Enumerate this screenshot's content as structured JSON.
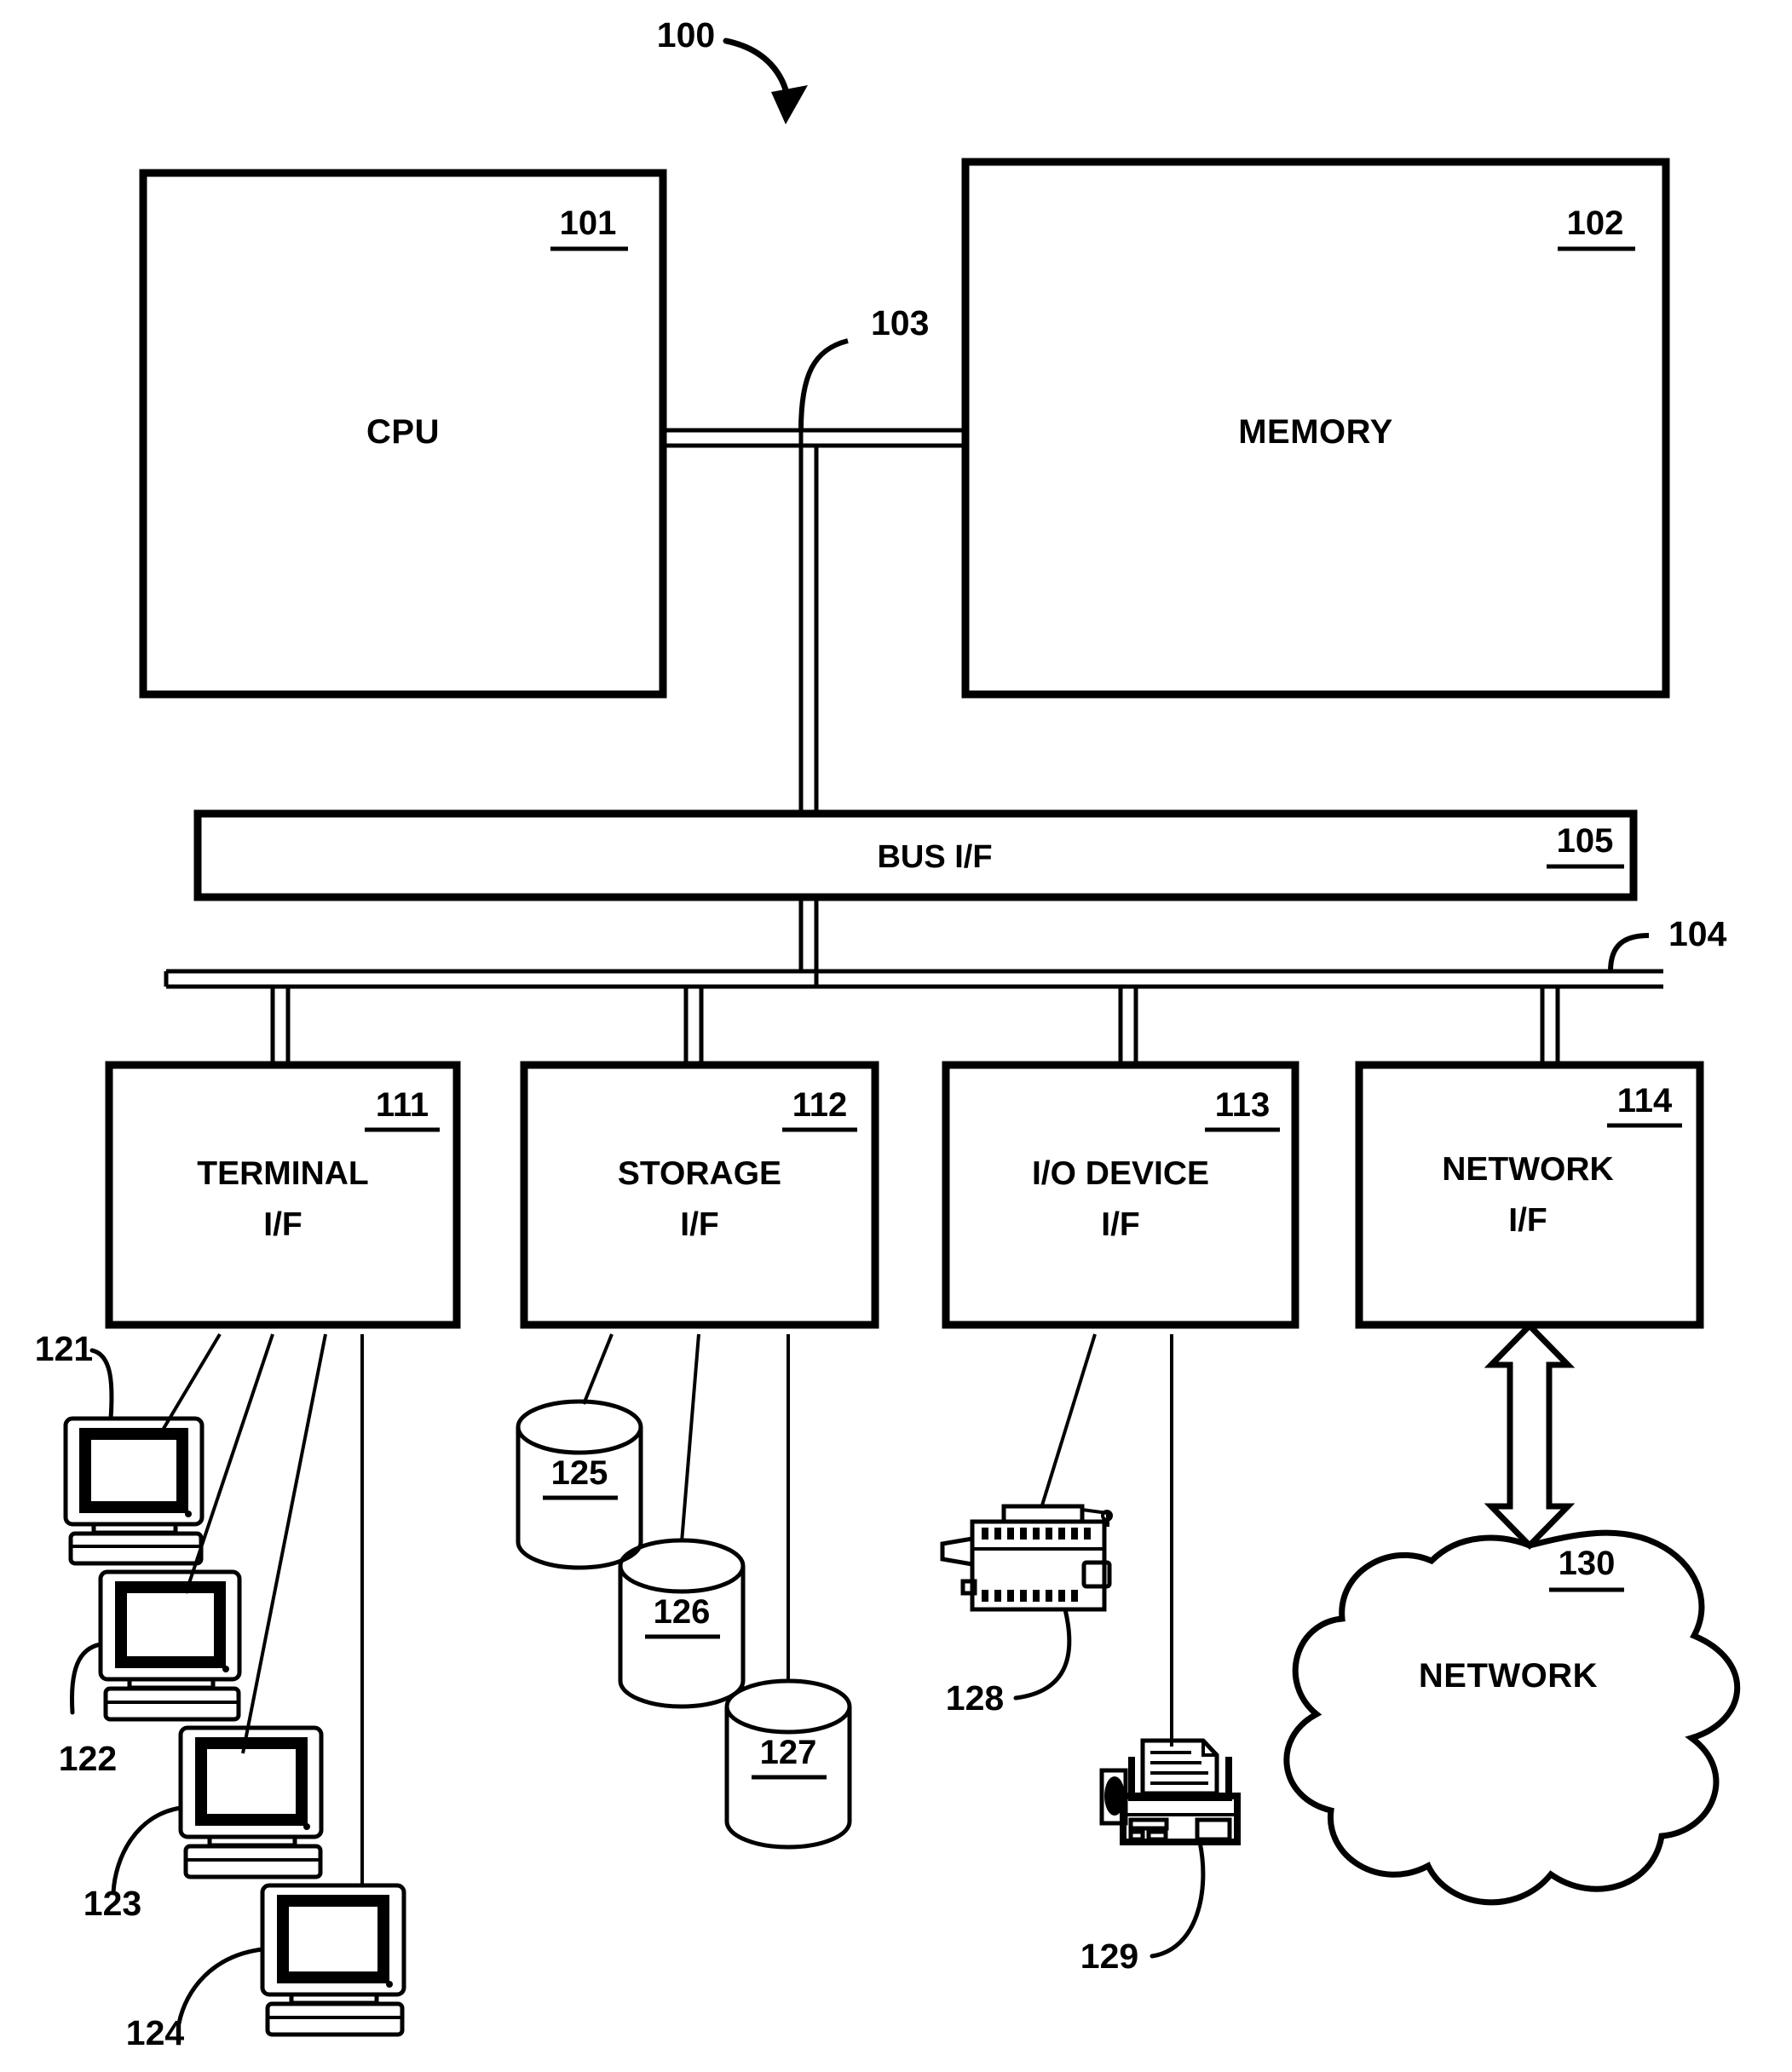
{
  "figure": {
    "title_ref": "100",
    "kind": "computer-system-block-diagram"
  },
  "blocks": {
    "cpu": {
      "label": "CPU",
      "ref": "101"
    },
    "memory": {
      "label": "MEMORY",
      "ref": "102"
    },
    "bus_if": {
      "label": "BUS I/F",
      "ref": "105"
    },
    "terminal_if": {
      "label_line1": "TERMINAL",
      "label_line2": "I/F",
      "ref": "111"
    },
    "storage_if": {
      "label_line1": "STORAGE",
      "label_line2": "I/F",
      "ref": "112"
    },
    "io_if": {
      "label_line1": "I/O DEVICE",
      "label_line2": "I/F",
      "ref": "113"
    },
    "network_if": {
      "label_line1": "NETWORK",
      "label_line2": "I/F",
      "ref": "114"
    }
  },
  "buses": {
    "memory_bus_ref": "103",
    "io_bus_ref": "104"
  },
  "terminals": [
    {
      "ref": "121",
      "icon": "desktop-computer-icon"
    },
    {
      "ref": "122",
      "icon": "desktop-computer-icon"
    },
    {
      "ref": "123",
      "icon": "desktop-computer-icon"
    },
    {
      "ref": "124",
      "icon": "desktop-computer-icon"
    }
  ],
  "storage_devices": [
    {
      "ref": "125",
      "icon": "disk-cylinder-icon"
    },
    {
      "ref": "126",
      "icon": "disk-cylinder-icon"
    },
    {
      "ref": "127",
      "icon": "disk-cylinder-icon"
    }
  ],
  "io_devices": [
    {
      "ref": "128",
      "icon": "tape-drive-icon"
    },
    {
      "ref": "129",
      "icon": "printer-icon"
    }
  ],
  "network": {
    "label": "NETWORK",
    "ref": "130",
    "icon": "cloud-icon",
    "link_icon": "double-headed-arrow-icon"
  },
  "colors": {
    "ink": "#000000",
    "paper": "#ffffff"
  }
}
